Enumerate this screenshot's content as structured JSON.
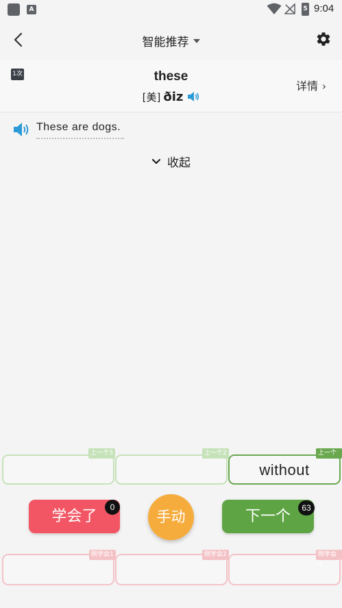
{
  "status_bar": {
    "app_badge_letter": "A",
    "battery_level": "5",
    "time": "9:04",
    "icons": [
      "app-icon",
      "app-a-icon",
      "wifi-icon",
      "no-signal-icon",
      "battery-icon"
    ]
  },
  "header": {
    "title": "智能推荐",
    "icons": [
      "back-arrow-icon",
      "dropdown-triangle-icon",
      "gear-icon"
    ]
  },
  "word_card": {
    "count_badge": "1次",
    "word": "these",
    "phonetic_tag": "[美]",
    "phonetic": "ðiz",
    "detail_label": "详情",
    "detail_chevron": "›"
  },
  "sentence": {
    "text": "These are dogs."
  },
  "collapse": {
    "label": "收起"
  },
  "previous_slots": [
    {
      "tag": "上一个3",
      "word": ""
    },
    {
      "tag": "上一个2",
      "word": ""
    },
    {
      "tag": "上一个1",
      "word": "without"
    }
  ],
  "actions": {
    "learned_label": "学会了",
    "learned_count": "0",
    "manual_label": "手动",
    "next_label": "下一个",
    "next_count": "63"
  },
  "learned_slots": [
    {
      "tag": "刚学会1"
    },
    {
      "tag": "刚学会2"
    },
    {
      "tag": "刚学会3"
    }
  ],
  "colors": {
    "learned_button": "#f25563",
    "next_button": "#5ea444",
    "manual_button": "#f6ac3c",
    "speaker_blue": "#2b9ad6",
    "previous_slot_border": "#c6e2b9",
    "active_slot_border": "#6aa84f",
    "learned_slot_border": "#f4c2c6"
  }
}
